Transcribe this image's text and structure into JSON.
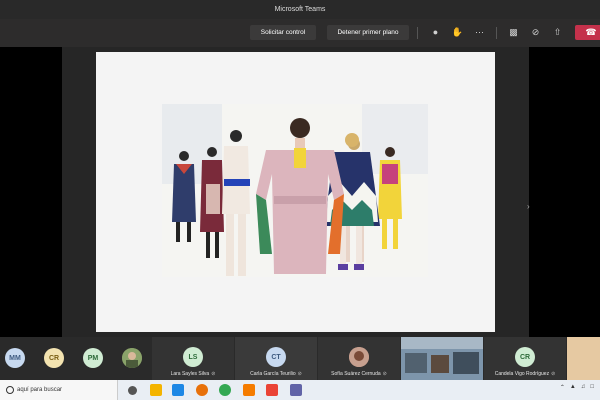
{
  "window": {
    "title": "Microsoft Teams"
  },
  "toolbar": {
    "request_control": "Solicitar control",
    "stop_presenting": "Detener primer plano",
    "icons": [
      "participants-icon",
      "raise-hand-icon",
      "more-options-icon",
      "camera-icon",
      "mic-off-icon",
      "share-tray-icon",
      "hang-up-icon"
    ]
  },
  "participants": {
    "avatars": [
      {
        "initials": "MM",
        "color": "#c7d9f0"
      },
      {
        "initials": "CR",
        "color": "#f3e3b0"
      },
      {
        "initials": "PM",
        "color": "#d0ecd3"
      }
    ],
    "tiles": [
      {
        "initials": "LS",
        "name": "Lara Sayles Silva",
        "color": "#d0ecd3"
      },
      {
        "initials": "CT",
        "name": "Carla García Teurilio",
        "color": "#c7d9f0"
      },
      {
        "initials": "",
        "name": "Sofía Suárez Cernuda",
        "color": "#b9857a"
      },
      {
        "initials": "",
        "name": "",
        "color": "#6f8aa3"
      },
      {
        "initials": "CR",
        "name": "Candela Vigo Rodríguez",
        "color": "#d0ecd3"
      }
    ]
  },
  "taskbar": {
    "search_placeholder": "aquí para buscar",
    "apps": [
      "#1e88e5",
      "#f4b400",
      "#e8710a",
      "#34a853",
      "#7b83eb",
      "#ea4335",
      "#fbbc05",
      "#4285f4",
      "#e53935",
      "#6264a7"
    ]
  }
}
